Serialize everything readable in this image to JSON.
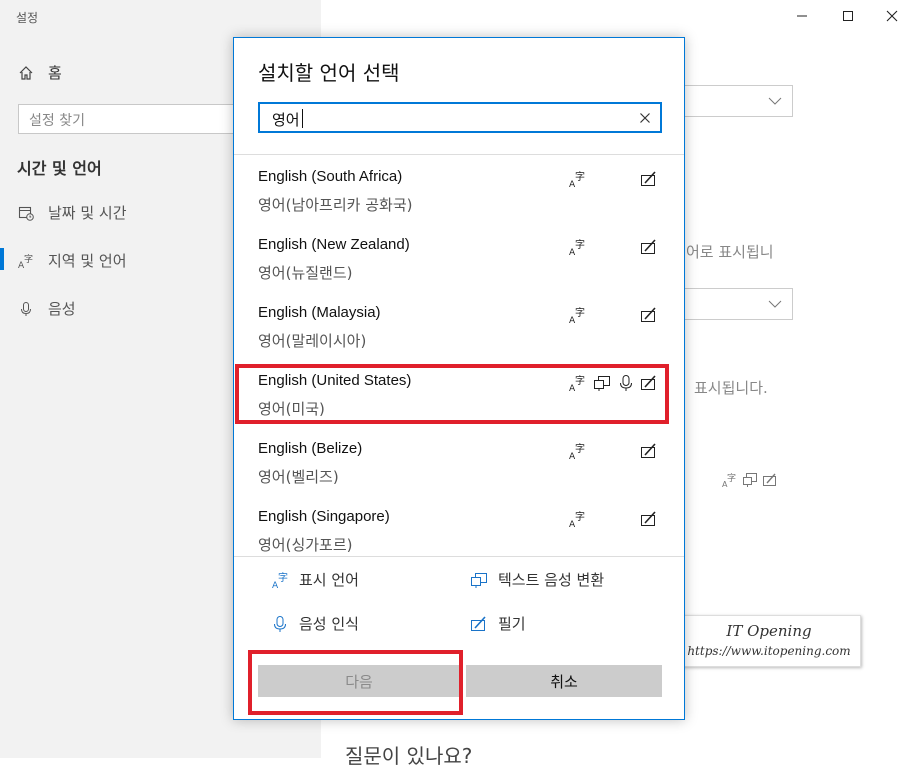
{
  "window": {
    "title": "설정",
    "minimize_icon": "minimize-icon",
    "maximize_icon": "maximize-icon",
    "close_icon": "close-icon"
  },
  "sidebar": {
    "home_label": "홈",
    "search_placeholder": "설정 찾기",
    "section_title": "시간 및 언어",
    "items": [
      {
        "label": "날짜 및 시간",
        "icon": "calendar-clock-icon"
      },
      {
        "label": "지역 및 언어",
        "icon": "language-icon"
      },
      {
        "label": "음성",
        "icon": "microphone-icon"
      }
    ]
  },
  "background": {
    "text1": "어로 표시됩니",
    "text2": "표시됩니다.",
    "text3": "질문이 있나요?"
  },
  "dialog": {
    "title": "설치할 언어 선택",
    "search_value": "영어",
    "languages": [
      {
        "name": "English (South Africa)",
        "native": "영어(남아프리카 공화국)",
        "features": [
          "display-language",
          "handwriting"
        ]
      },
      {
        "name": "English (New Zealand)",
        "native": "영어(뉴질랜드)",
        "features": [
          "display-language",
          "handwriting"
        ]
      },
      {
        "name": "English (Malaysia)",
        "native": "영어(말레이시아)",
        "features": [
          "display-language",
          "handwriting"
        ]
      },
      {
        "name": "English (United States)",
        "native": "영어(미국)",
        "features": [
          "display-language",
          "text-to-speech",
          "speech-recognition",
          "handwriting"
        ]
      },
      {
        "name": "English (Belize)",
        "native": "영어(벨리즈)",
        "features": [
          "display-language",
          "handwriting"
        ]
      },
      {
        "name": "English (Singapore)",
        "native": "영어(싱가포르)",
        "features": [
          "display-language",
          "handwriting"
        ]
      }
    ],
    "legend": {
      "display_language": "표시 언어",
      "text_to_speech": "텍스트 음성 변환",
      "speech_recognition": "음성 인식",
      "handwriting": "필기"
    },
    "next_label": "다음",
    "cancel_label": "취소"
  },
  "watermark": {
    "line1": "IT Opening",
    "line2": "https://www.itopening.com"
  },
  "colors": {
    "accent": "#0078d7",
    "annotation_red": "#e0202b",
    "button_gray": "#cccccc"
  }
}
